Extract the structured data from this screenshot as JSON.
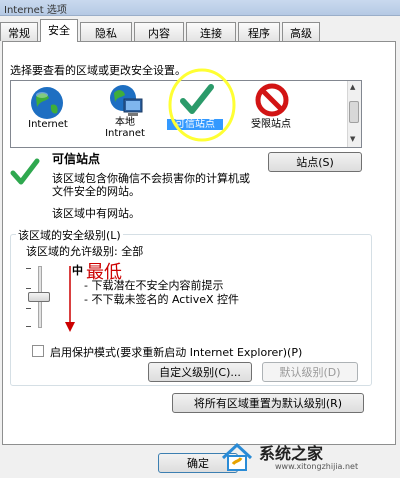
{
  "window": {
    "title": "Internet 选项"
  },
  "tabs": [
    {
      "label": "常规",
      "active": false
    },
    {
      "label": "安全",
      "active": true
    },
    {
      "label": "隐私",
      "active": false
    },
    {
      "label": "内容",
      "active": false
    },
    {
      "label": "连接",
      "active": false
    },
    {
      "label": "程序",
      "active": false
    },
    {
      "label": "高级",
      "active": false
    }
  ],
  "security": {
    "instruction": "选择要查看的区域或更改安全设置。",
    "zones": [
      {
        "label": "Internet"
      },
      {
        "label_line1": "本地",
        "label_line2": "Intranet"
      },
      {
        "label": "可信站点",
        "selected": true
      },
      {
        "label": "受限站点"
      }
    ],
    "zone_info": {
      "title": "可信站点",
      "desc_line1": "该区域包含你确信不会损害你的计算机或",
      "desc_line2": "文件安全的网站。",
      "status": "该区域中有网站。"
    },
    "sites_button": "站点(S)",
    "level_group": {
      "legend": "该区域的安全级别(L)",
      "allowed": "该区域的允许级别: 全部",
      "level_name": "中",
      "bullet1": "- 下载潜在不安全内容前提示",
      "bullet2": "- 不下载未签名的 ActiveX 控件",
      "slider_level_index": 1,
      "slider_levels": 4
    },
    "protected_mode": {
      "label": "启用保护模式(要求重新启动 Internet Explorer)(P)",
      "checked": false
    },
    "custom_level_button": "自定义级别(C)...",
    "default_level_button": "默认级别(D)",
    "reset_all_button": "将所有区域重置为默认级别(R)"
  },
  "annotation": {
    "text": "最低",
    "color": "#cc0000"
  },
  "highlight_color": "#ffff33",
  "footer": {
    "ok_button": "确定"
  },
  "watermark": {
    "text": "系统之家",
    "url": "www.xitongzhijia.net"
  }
}
